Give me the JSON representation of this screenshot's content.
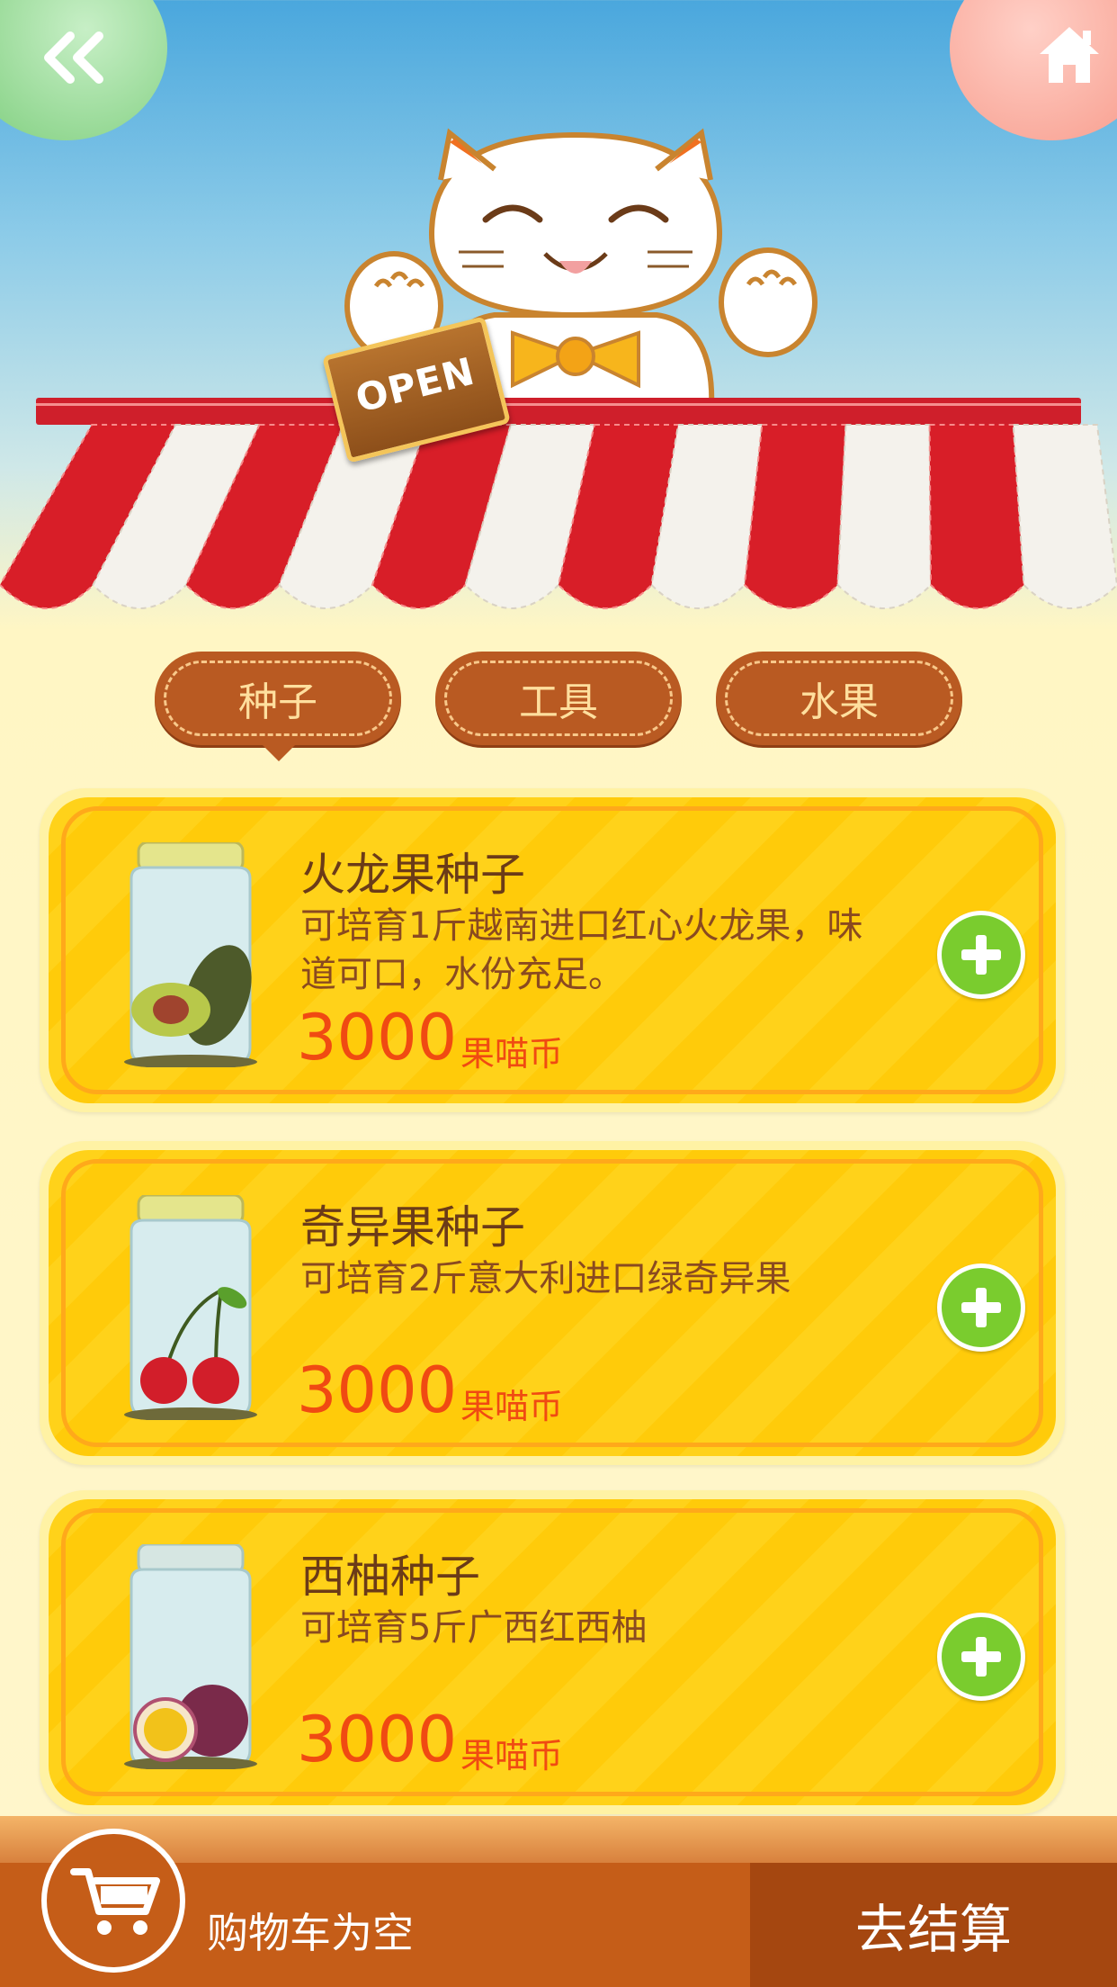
{
  "header": {
    "sign_text": "OPEN"
  },
  "tabs": [
    {
      "label": "种子",
      "selected": true
    },
    {
      "label": "工具",
      "selected": false
    },
    {
      "label": "水果",
      "selected": false
    }
  ],
  "products": [
    {
      "name": "火龙果种子",
      "desc": "可培育1斤越南进口红心火龙果，味道可口，水份充足。",
      "price": "3000",
      "unit": "果喵币",
      "fruit_icon": "avocado-icon"
    },
    {
      "name": "奇异果种子",
      "desc": "可培育2斤意大利进口绿奇异果",
      "price": "3000",
      "unit": "果喵币",
      "fruit_icon": "cherry-icon"
    },
    {
      "name": "西柚种子",
      "desc": "可培育5斤广西红西柚",
      "price": "3000",
      "unit": "果喵币",
      "fruit_icon": "passion-fruit-icon"
    }
  ],
  "cart": {
    "status": "购物车为空",
    "checkout_label": "去结算"
  },
  "colors": {
    "accent_green": "#7acc2e",
    "card_yellow": "#ffd21a",
    "price_red": "#f04a12",
    "bar_brown": "#c55d18"
  }
}
